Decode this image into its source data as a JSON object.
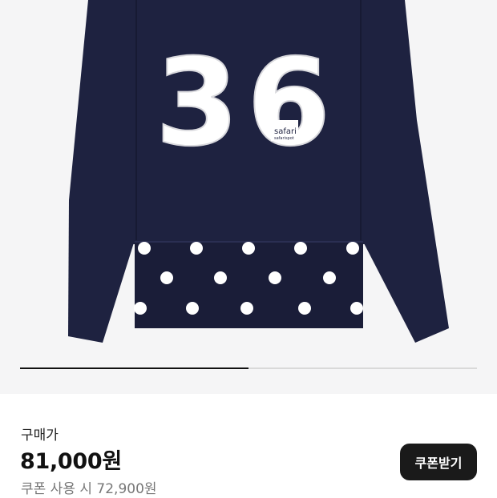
{
  "product_image": {
    "jersey_number": "36",
    "brand_label": "safari",
    "brand_sublabel": "safarispot",
    "colors": {
      "background": "#f5f5f6",
      "shirt": "#1e2240",
      "dot_panel": "#1a1d38",
      "print": "#ffffff"
    }
  },
  "gallery": {
    "progress": 0.5
  },
  "price_section": {
    "label": "구매가",
    "price": "81,000원",
    "coupon_price": "쿠폰 사용 시 72,900원",
    "coupon_button_label": "쿠폰받기"
  }
}
